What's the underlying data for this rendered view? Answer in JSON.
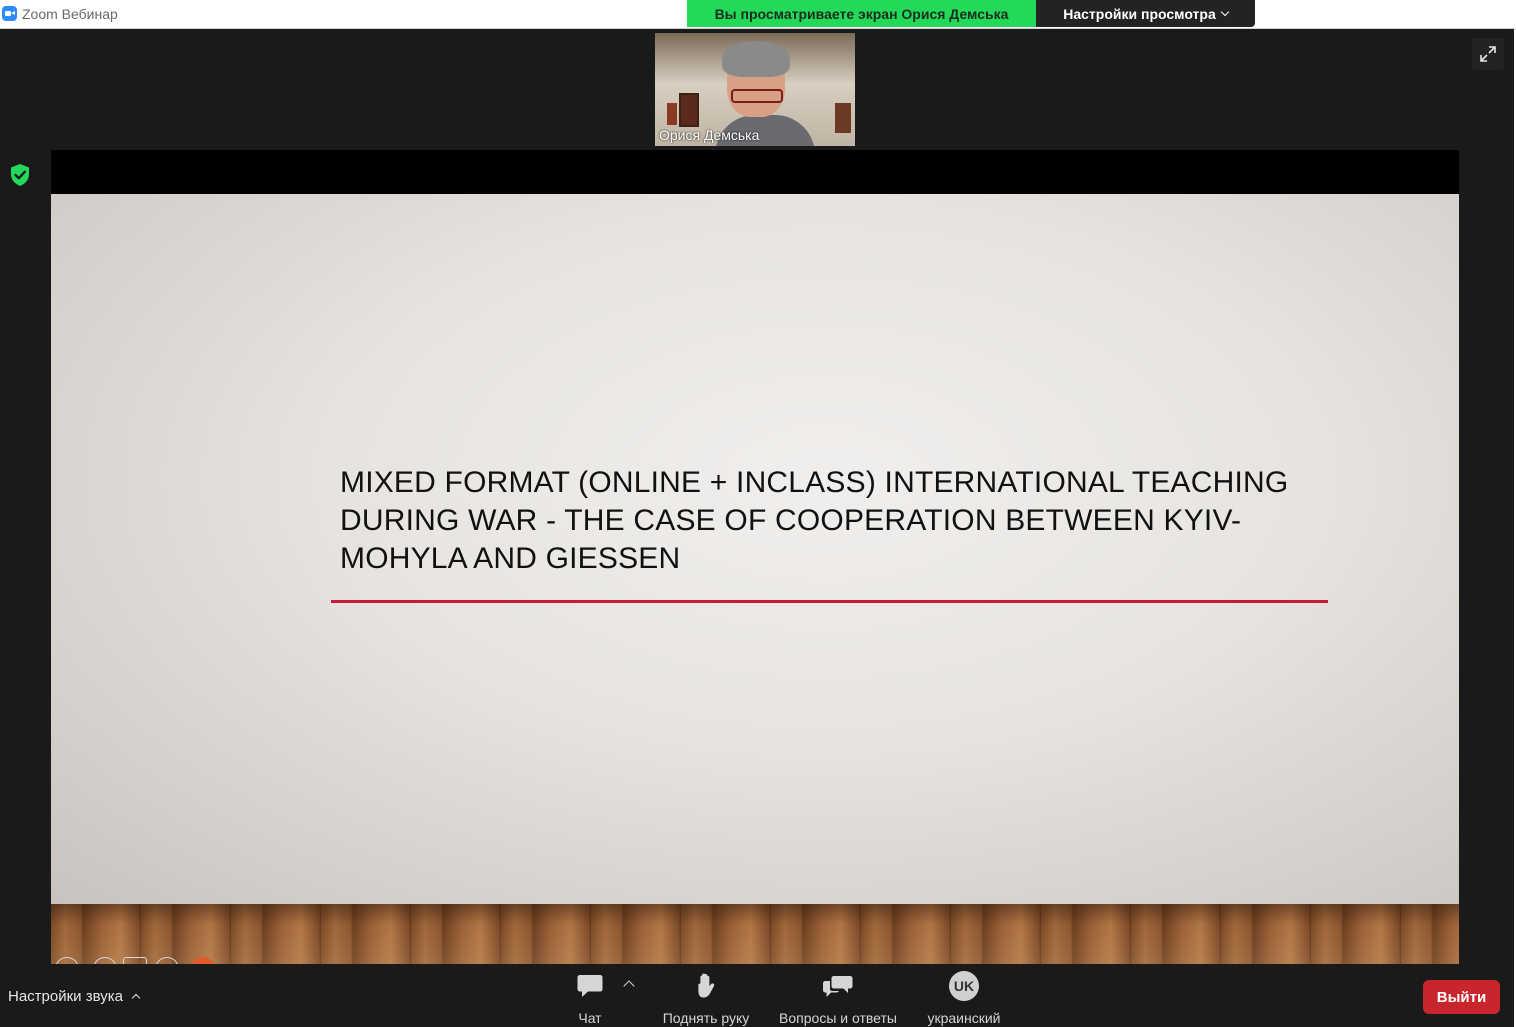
{
  "window": {
    "title": "Zoom Вебинар"
  },
  "banner": {
    "viewing_text": "Вы просматриваете экран Орися Демська",
    "view_settings_label": "Настройки просмотра"
  },
  "speaker": {
    "name": "Орися Демська"
  },
  "slide": {
    "title_line1": "MIXED FORMAT (ONLINE + INCLASS) INTERNATIONAL TEACHING",
    "title_line2": "DURING WAR - THE CASE OF COOPERATION BETWEEN KYIV-",
    "title_line3": "MOHYLA AND GIESSEN",
    "rule_color": "#c8193c"
  },
  "toolbar": {
    "audio_settings_label": "Настройки звука",
    "chat_label": "Чат",
    "raise_hand_label": "Поднять руку",
    "qa_label": "Вопросы и ответы",
    "language_code": "UK",
    "language_label": "украинский",
    "leave_label": "Выйти"
  },
  "colors": {
    "banner_green": "#23d959",
    "leave_red": "#c8262c",
    "toolbar_bg": "#1a1a1a",
    "shield_green": "#23d959"
  },
  "icons": {
    "app": "zoom-logo-icon",
    "security": "shield-check-icon",
    "fullscreen": "fullscreen-icon",
    "chat": "chat-bubble-icon",
    "raise_hand": "hand-icon",
    "qa": "qa-bubbles-icon"
  }
}
